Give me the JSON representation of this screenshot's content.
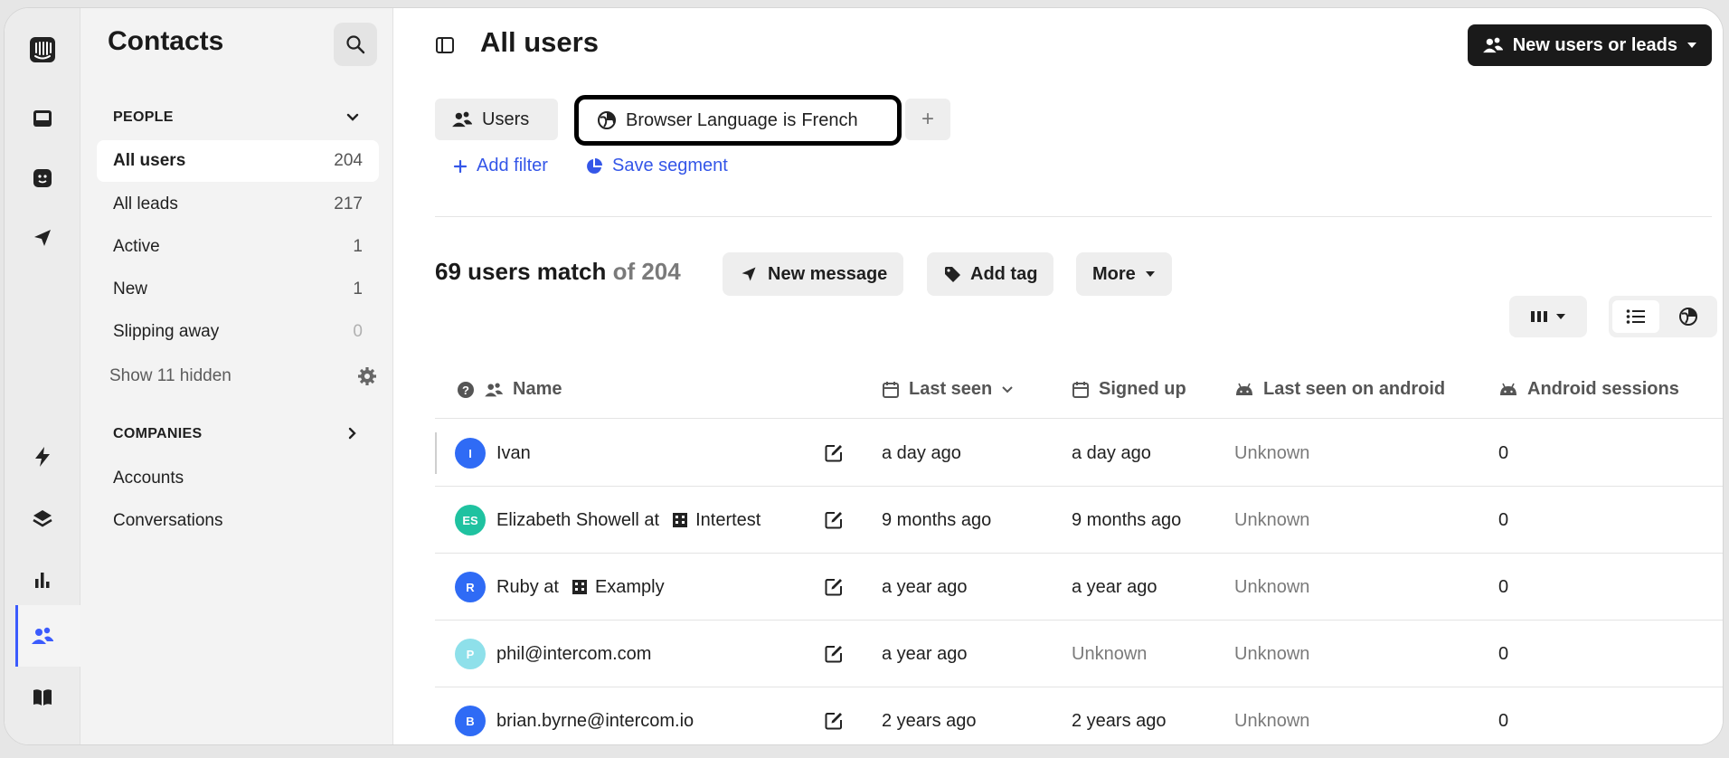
{
  "app": {
    "rail_icons": [
      "intercom-logo-icon",
      "inbox-icon",
      "fin-bot-icon",
      "outbound-send-icon",
      "automation-bolt-icon",
      "knowledge-layers-icon",
      "reports-chart-icon",
      "contacts-people-icon",
      "help-center-book-icon"
    ],
    "accent_color": "#3b5bfd"
  },
  "sidebar": {
    "title": "Contacts",
    "people_heading": "PEOPLE",
    "items": [
      {
        "label": "All users",
        "count": "204",
        "active": true
      },
      {
        "label": "All leads",
        "count": "217"
      },
      {
        "label": "Active",
        "count": "1"
      },
      {
        "label": "New",
        "count": "1"
      },
      {
        "label": "Slipping away",
        "count": "0"
      }
    ],
    "show_hidden": "Show 11 hidden",
    "companies_heading": "COMPANIES",
    "company_items": [
      "Accounts",
      "Conversations"
    ]
  },
  "main": {
    "title": "All users",
    "new_button": "New users or leads",
    "chips": {
      "users": "Users",
      "filter_attr": "Browser Language",
      "filter_op": "is",
      "filter_value": "French",
      "plus": "+"
    },
    "add_filter": "Add filter",
    "save_segment": "Save segment",
    "match_count": "69 users match",
    "match_of": "of 204",
    "actions": {
      "new_message": "New message",
      "add_tag": "Add tag",
      "more": "More"
    },
    "columns": [
      "Name",
      "Last seen",
      "Signed up",
      "Last seen on android",
      "Android sessions"
    ],
    "rows": [
      {
        "initials": "I",
        "color": "#2f6bf5",
        "name": "Ivan",
        "company": "",
        "last_seen": "a day ago",
        "signed_up": "a day ago",
        "android": "Unknown",
        "sessions": "0"
      },
      {
        "initials": "ES",
        "color": "#1fc2a0",
        "name": "Elizabeth Showell at",
        "company": "Intertest",
        "last_seen": "9 months ago",
        "signed_up": "9 months ago",
        "android": "Unknown",
        "sessions": "0"
      },
      {
        "initials": "R",
        "color": "#2f6bf5",
        "name": "Ruby at",
        "company": "Examply",
        "last_seen": "a year ago",
        "signed_up": "a year ago",
        "android": "Unknown",
        "sessions": "0"
      },
      {
        "initials": "P",
        "color": "#8ee0ea",
        "name": "phil@intercom.com",
        "company": "",
        "last_seen": "a year ago",
        "signed_up": "Unknown",
        "android": "Unknown",
        "sessions": "0"
      },
      {
        "initials": "B",
        "color": "#2f6bf5",
        "name": "brian.byrne@intercom.io",
        "company": "",
        "last_seen": "2 years ago",
        "signed_up": "2 years ago",
        "android": "Unknown",
        "sessions": "0"
      }
    ]
  }
}
